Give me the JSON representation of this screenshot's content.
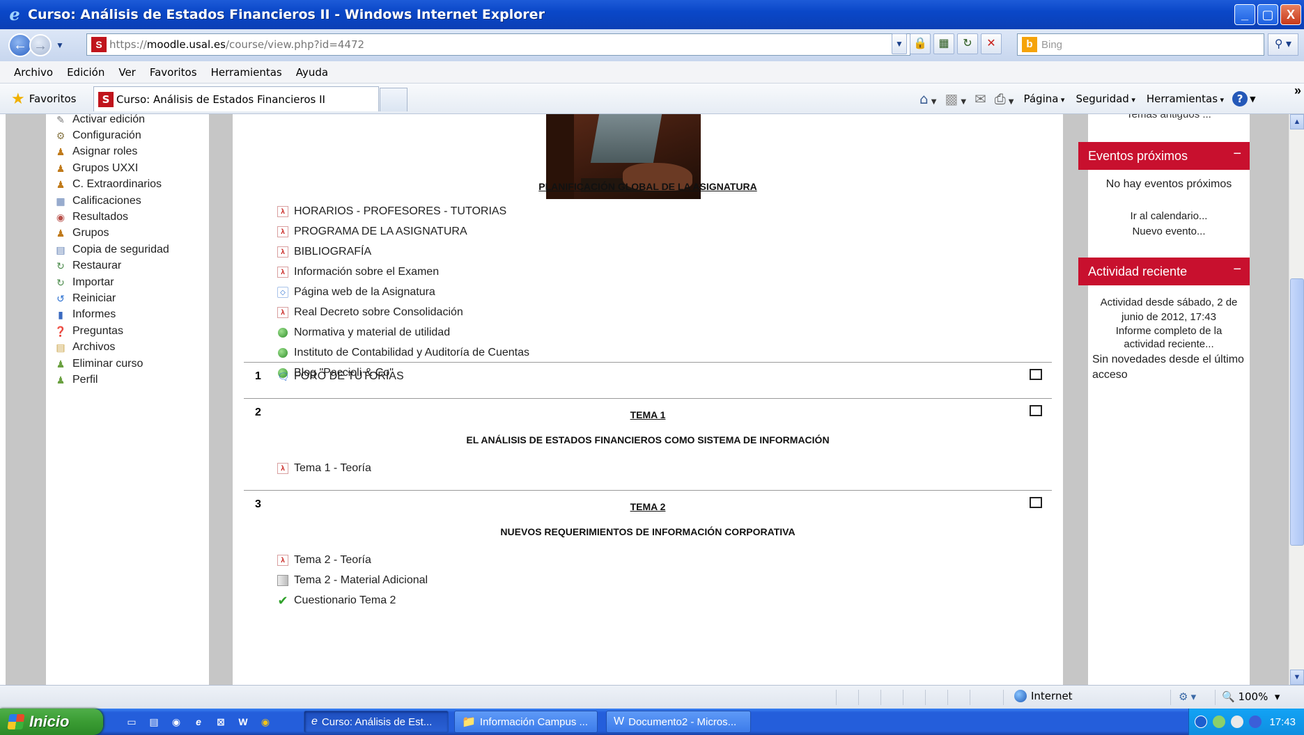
{
  "window": {
    "title": "Curso: Análisis de Estados Financieros II - Windows Internet Explorer",
    "min": "_",
    "max": "▢",
    "close": "X"
  },
  "addressbar": {
    "url_host_prefix": "https://",
    "url_host": "moodle.usal.es",
    "url_path": "/course/view.php?id=4472",
    "search_placeholder": "Bing"
  },
  "menu": [
    "Archivo",
    "Edición",
    "Ver",
    "Favoritos",
    "Herramientas",
    "Ayuda"
  ],
  "favbar": {
    "favorites_label": "Favoritos",
    "tab_title": "Curso: Análisis de Estados Financieros II",
    "commands": [
      "Página",
      "Seguridad",
      "Herramientas"
    ]
  },
  "admin_menu": [
    {
      "label": "Activar edición",
      "icon": "edit-icon"
    },
    {
      "label": "Configuración",
      "icon": "settings-icon"
    },
    {
      "label": "Asignar roles",
      "icon": "roles-icon"
    },
    {
      "label": "Grupos UXXI",
      "icon": "groups-icon"
    },
    {
      "label": "C. Extraordinarios",
      "icon": "groups-icon"
    },
    {
      "label": "Calificaciones",
      "icon": "grades-icon"
    },
    {
      "label": "Resultados",
      "icon": "results-icon"
    },
    {
      "label": "Grupos",
      "icon": "group-icon"
    },
    {
      "label": "Copia de seguridad",
      "icon": "backup-icon"
    },
    {
      "label": "Restaurar",
      "icon": "restore-icon"
    },
    {
      "label": "Importar",
      "icon": "import-icon"
    },
    {
      "label": "Reiniciar",
      "icon": "reset-icon"
    },
    {
      "label": "Informes",
      "icon": "reports-icon"
    },
    {
      "label": "Preguntas",
      "icon": "questions-icon"
    },
    {
      "label": "Archivos",
      "icon": "files-icon"
    },
    {
      "label": "Eliminar curso",
      "icon": "user-icon"
    },
    {
      "label": "Perfil",
      "icon": "user-icon"
    }
  ],
  "course": {
    "planning_title": "PLANIFICACIÓN GLOBAL DE LA ASIGNATURA",
    "section0_resources": [
      {
        "label": "HORARIOS - PROFESORES - TUTORIAS",
        "icon": "pdf-icon"
      },
      {
        "label": "PROGRAMA DE LA ASIGNATURA",
        "icon": "pdf-icon"
      },
      {
        "label": "BIBLIOGRAFÍA",
        "icon": "pdf-icon"
      },
      {
        "label": "Información sobre el Examen",
        "icon": "pdf-icon"
      },
      {
        "label": "Página web de la Asignatura",
        "icon": "web-icon"
      },
      {
        "label": "Real Decreto sobre Consolidación",
        "icon": "pdf-icon"
      },
      {
        "label": "Normativa y material de utilidad",
        "icon": "globe-icon"
      },
      {
        "label": "Instituto de Contabilidad y Auditoría de Cuentas",
        "icon": "globe-icon"
      },
      {
        "label": "Blog \"Paccioli & Co\"",
        "icon": "globe-icon"
      }
    ],
    "sections": [
      {
        "num": "1",
        "forum": "FORO DE TUTORÍAS"
      },
      {
        "num": "2",
        "title": "TEMA 1",
        "subtitle": "EL ANÁLISIS DE ESTADOS FINANCIEROS COMO SISTEMA DE INFORMACIÓN",
        "resources": [
          {
            "label": "Tema 1 - Teoría",
            "icon": "pdf-icon"
          }
        ]
      },
      {
        "num": "3",
        "title": "TEMA 2",
        "subtitle": "NUEVOS REQUERIMIENTOS DE INFORMACIÓN CORPORATIVA",
        "resources": [
          {
            "label": "Tema 2 - Teoría",
            "icon": "pdf-icon"
          },
          {
            "label": "Tema 2 - Material Adicional",
            "icon": "zip-icon"
          },
          {
            "label": "Cuestionario Tema 2",
            "icon": "check-icon"
          }
        ]
      }
    ]
  },
  "blocks": {
    "old_topics": "Temas antiguos ...",
    "events": {
      "title": "Eventos próximos",
      "collapse": "−",
      "none": "No hay eventos próximos",
      "calendar_link": "Ir al calendario...",
      "new_event_link": "Nuevo evento..."
    },
    "activity": {
      "title": "Actividad reciente",
      "collapse": "−",
      "since": "Actividad desde sábado, 2 de junio de 2012, 17:43",
      "full_report": "Informe completo de la actividad reciente...",
      "no_news": "Sin novedades desde el último acceso"
    }
  },
  "statusbar": {
    "zone": "Internet",
    "zoom": "100%"
  },
  "taskbar": {
    "start": "Inicio",
    "buttons": [
      {
        "label": "Curso: Análisis de Est...",
        "icon": "ie-icon",
        "active": true
      },
      {
        "label": "Información Campus ...",
        "icon": "folder-icon",
        "active": false
      },
      {
        "label": "Documento2 - Micros...",
        "icon": "word-icon",
        "active": false
      }
    ],
    "clock": "17:43"
  },
  "colors": {
    "block_header": "#c8102e",
    "frame_grey": "#c6c6c6",
    "xp_blue": "#245edb"
  }
}
